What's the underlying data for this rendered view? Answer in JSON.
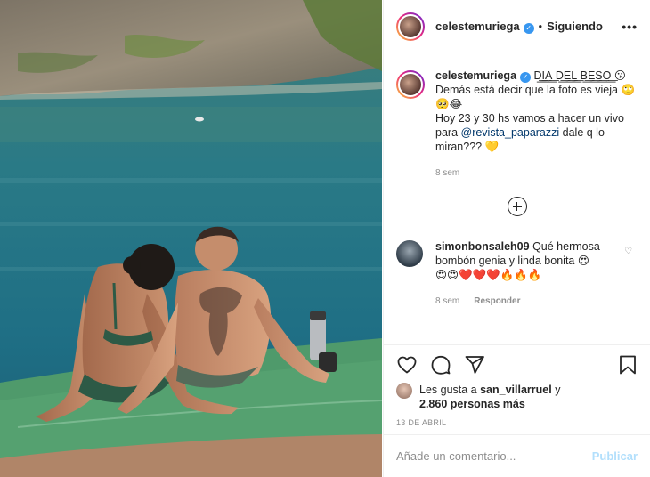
{
  "post": {
    "username": "celestemuriega",
    "follow_label": "Siguiendo",
    "more_label": "•••"
  },
  "caption": {
    "username": "celestemuriega",
    "line1": "D͟͟I͟͟A͟͟ D͟͟E͟͟L͟͟ B͟͟E͟͟S͟͟O͟͟ 😗",
    "line2": "Demás está decir que la foto es vieja 🙄🥺😂",
    "line3_prefix": "Hoy 23 y 30 hs vamos a hacer un vivo para ",
    "mention": "@revista_paparazzi",
    "line3_suffix": " dale q lo miran??? 💛",
    "time": "8 sem"
  },
  "comment": {
    "username": "simonbonsaleh09",
    "text": " Qué hermosa bombón genia y linda bonita 😍",
    "emojis": "😍😍❤️❤️❤️🔥🔥🔥",
    "time": "8 sem",
    "reply_label": "Responder"
  },
  "likes": {
    "prefix": "Les gusta a ",
    "user": "san_villarruel",
    "middle": " y",
    "count": "2.860 personas más"
  },
  "date": "13 DE ABRIL",
  "add_comment": {
    "placeholder": "Añade un comentario...",
    "publish_label": "Publicar"
  },
  "icons": {
    "verified": "verified-badge-icon",
    "like": "heart-icon",
    "comment": "comment-bubble-icon",
    "share": "paper-plane-icon",
    "save": "bookmark-icon",
    "load_more": "plus-circle-icon"
  }
}
